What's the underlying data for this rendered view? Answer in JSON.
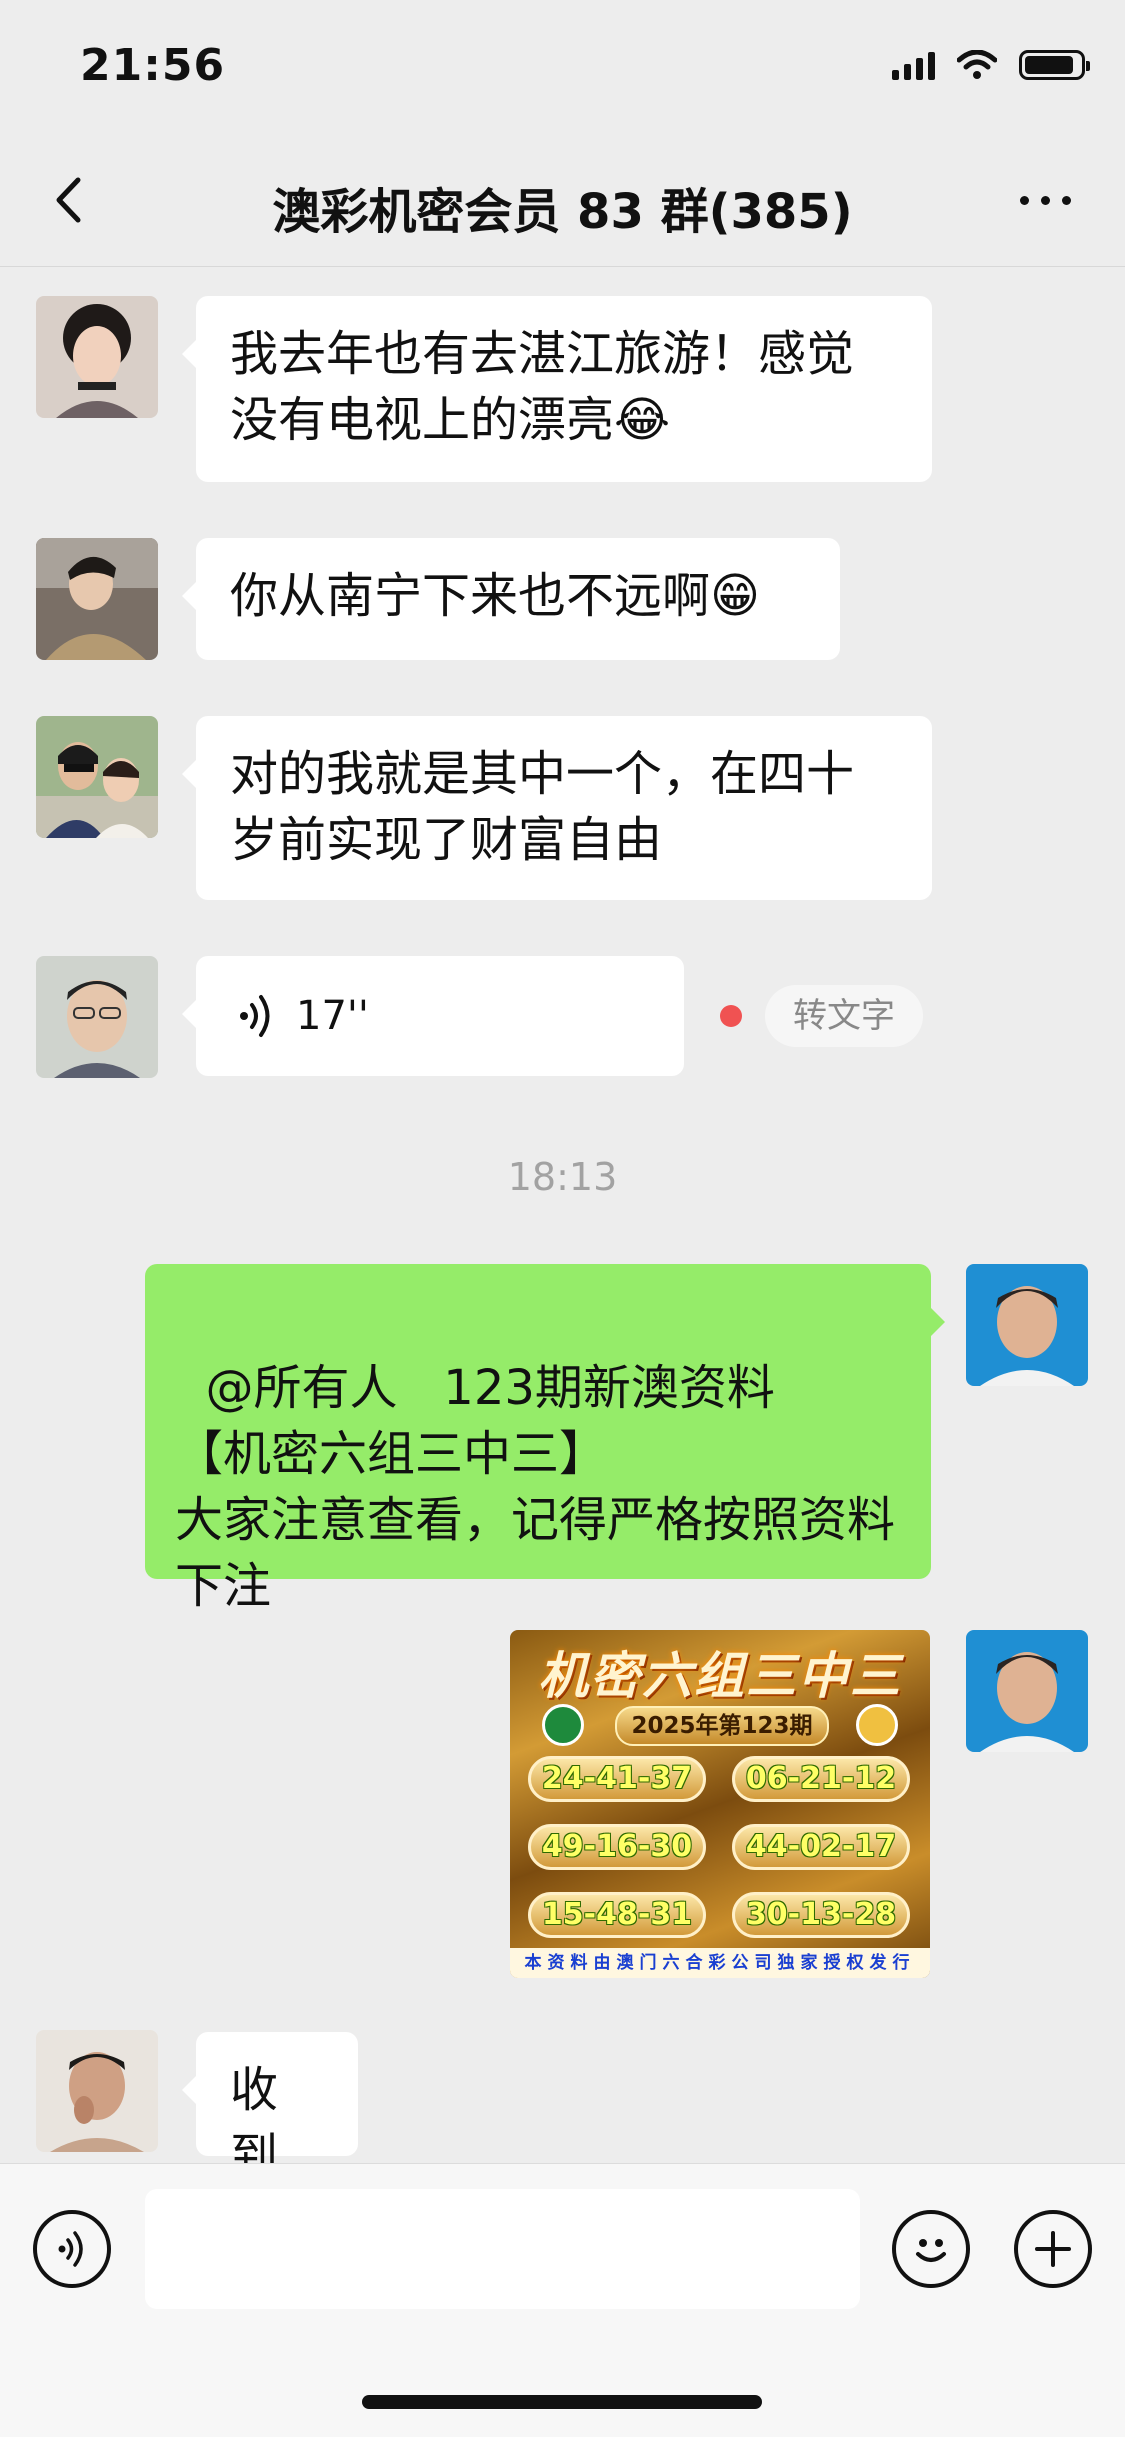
{
  "status_bar": {
    "time": "21:56"
  },
  "header": {
    "title": "澳彩机密会员 83 群(385)"
  },
  "messages": [
    {
      "text": "我去年也有去湛江旅游！感觉没有电视上的漂亮😂"
    },
    {
      "text": "你从南宁下来也不远啊😁"
    },
    {
      "text": "对的我就是其中一个，在四十岁前实现了财富自由"
    },
    {
      "voice_duration": "17''",
      "transcribe_label": "转文字"
    },
    {
      "timestamp": "18:13"
    },
    {
      "text": "@所有人   123期新澳资料\n【机密六组三中三】\n大家注意查看，记得严格按照资料下注"
    },
    {
      "image": {
        "title": "机密六组三中三",
        "issue": "2025年第123期",
        "numbers": [
          "24-41-37",
          "06-21-12",
          "49-16-30",
          "44-02-17",
          "15-48-31",
          "30-13-28"
        ],
        "footer": "本资料由澳门六合彩公司独家授权发行"
      }
    },
    {
      "text": "收到"
    }
  ],
  "input": {
    "placeholder": ""
  },
  "colors": {
    "background": "#ededed",
    "own_bubble": "#95ec69",
    "other_bubble": "#ffffff",
    "unread_dot": "#f05252"
  },
  "icons": [
    "back-icon",
    "more-icon",
    "voice-icon",
    "emoji-icon",
    "plus-icon"
  ]
}
